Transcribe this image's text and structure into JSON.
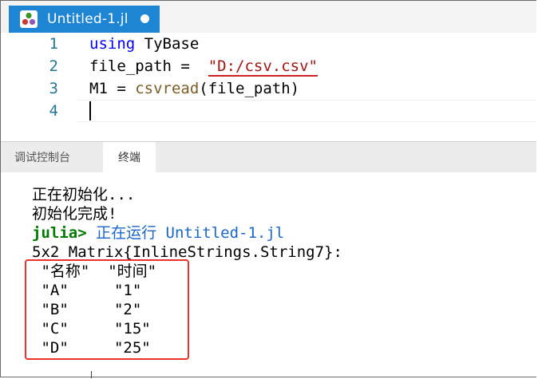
{
  "tab": {
    "filename": "Untitled-1.jl"
  },
  "editor": {
    "lines": [
      {
        "num": "1",
        "tokens": [
          "using",
          " TyBase"
        ]
      },
      {
        "num": "2",
        "tokens": [
          "file_path =  ",
          "\"D:/csv.csv\""
        ]
      },
      {
        "num": "3",
        "tokens": [
          "M1 = ",
          "csvread",
          "(file_path)"
        ]
      },
      {
        "num": "4",
        "tokens": []
      }
    ]
  },
  "panel": {
    "tabs": {
      "debug_console": "调试控制台",
      "terminal": "终端"
    }
  },
  "terminal": {
    "lines": [
      "正在初始化...",
      "初始化完成!",
      {
        "prompt": "julia>",
        "text": " 正在运行 Untitled-1.jl"
      },
      "5x2 Matrix{InlineStrings.String7}:",
      " \"名称\"  \"时间\"",
      " \"A\"     \"1\"",
      " \"B\"     \"2\"",
      " \"C\"     \"15\"",
      " \"D\"     \"25\""
    ]
  },
  "colors": {
    "tab_active": "#1e85d5",
    "keyword": "#0000ff",
    "string": "#a31515",
    "function": "#795e26",
    "line_number": "#237893",
    "prompt": "#007a00",
    "highlight_box": "#e8322a"
  }
}
